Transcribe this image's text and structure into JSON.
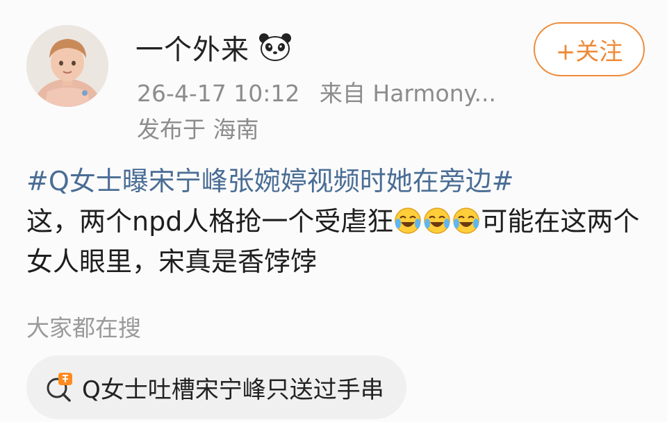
{
  "post": {
    "author": {
      "username": "一个外来",
      "badge_icon": "panda-icon",
      "avatar_icon": "avatar-portrait"
    },
    "timestamp": "26-4-17 10:12",
    "source": "来自 Harmony...",
    "location": "发布于 海南",
    "follow_label": "+关注",
    "topic": "#Q女士曝宋宁峰张婉婷视频时她在旁边#",
    "text_part1": "这，两个npd人格抢一个受虐狂",
    "emojis": [
      "laugh-cry-emoji",
      "laugh-cry-emoji",
      "laugh-cry-emoji"
    ],
    "text_part2": "可能在这两个女人眼里，宋真是香饽饽"
  },
  "search": {
    "heading": "大家都在搜",
    "icon": "hot-search-icon",
    "query": "Q女士吐槽宋宁峰只送过手串"
  },
  "colors": {
    "accent": "#ef8a38",
    "topic_link": "#4a6d95",
    "meta_text": "#8c8c8c"
  }
}
